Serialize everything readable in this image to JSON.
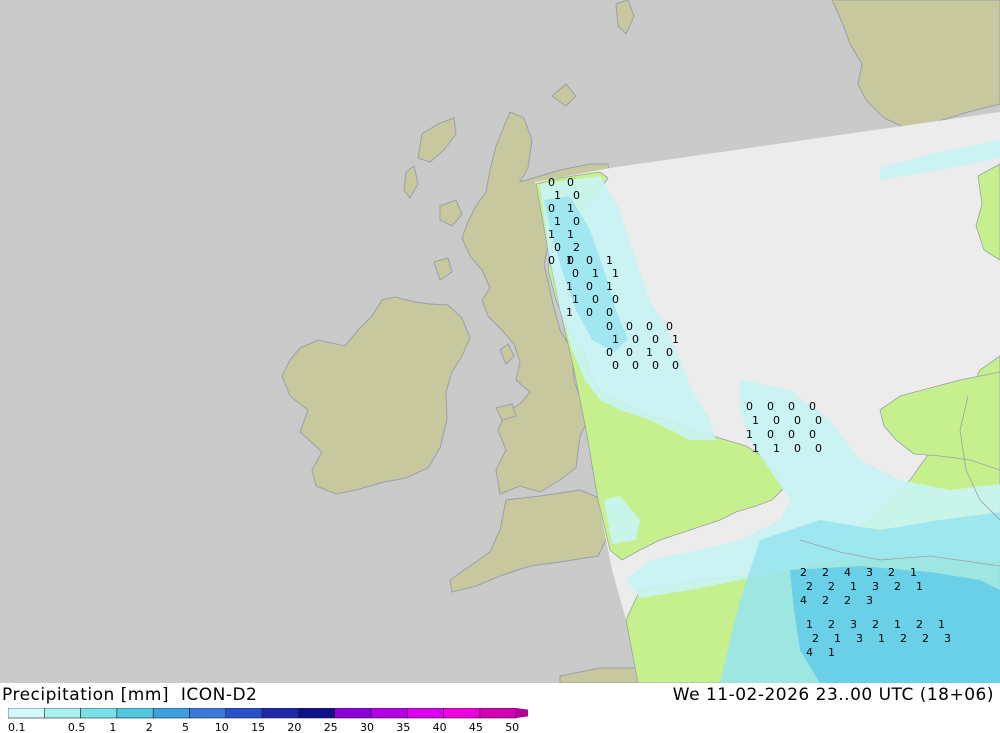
{
  "header": {
    "left_text": "Precipitation [mm]  ICON-D2",
    "right_text": "We 11-02-2026 23..00 UTC (18+06)"
  },
  "colors": {
    "ocean_outside": "#cacaca",
    "land_outside": "#c8c89e",
    "domain_dry": "#ececec",
    "land_inside": "#c6f08e",
    "precip_light": "#c8f4f4",
    "precip_mid": "#96e4f0",
    "precip_high": "#5ccbe8",
    "border_line": "#9aa0a8"
  },
  "legend": {
    "levels": [
      "0.1",
      "0.5",
      "1",
      "2",
      "5",
      "10",
      "15",
      "20",
      "25",
      "30",
      "35",
      "40",
      "45",
      "50"
    ],
    "colors": [
      "#d2fafa",
      "#aaf0f0",
      "#78e0e8",
      "#50c8e0",
      "#3ca0dc",
      "#3c78dc",
      "#2850c8",
      "#1e28a8",
      "#10108c",
      "#8c00dc",
      "#b400e6",
      "#dc00f0",
      "#f000dc",
      "#d200b4",
      "#b4009a"
    ]
  },
  "precip_values": [
    [
      "0",
      "0",
      "1",
      "0",
      "0",
      "1",
      "1",
      "0",
      "1",
      "1",
      "0",
      "2",
      "0",
      "0"
    ],
    [
      "1",
      "0",
      "1",
      "0",
      "1",
      "1",
      "1",
      "0",
      "1",
      "1",
      "0",
      "0",
      "1",
      "0",
      "0"
    ],
    [
      "0",
      "0",
      "0",
      "0",
      "1",
      "0",
      "0",
      "1",
      "0",
      "0",
      "1",
      "0",
      "0",
      "0",
      "0",
      "0"
    ],
    [
      "0",
      "0",
      "0",
      "0",
      "1",
      "0",
      "0",
      "0",
      "1",
      "0",
      "0",
      "0",
      "1",
      "1",
      "0",
      "0"
    ],
    [
      "2",
      "2",
      "4",
      "3",
      "2",
      "1",
      "2",
      "2",
      "1",
      "3",
      "2",
      "1",
      "4",
      "2",
      "2",
      "3"
    ],
    [
      "1",
      "2",
      "3",
      "2",
      "1",
      "2",
      "1",
      "2",
      "1",
      "3",
      "1",
      "2",
      "2",
      "3",
      "4",
      "1"
    ]
  ]
}
